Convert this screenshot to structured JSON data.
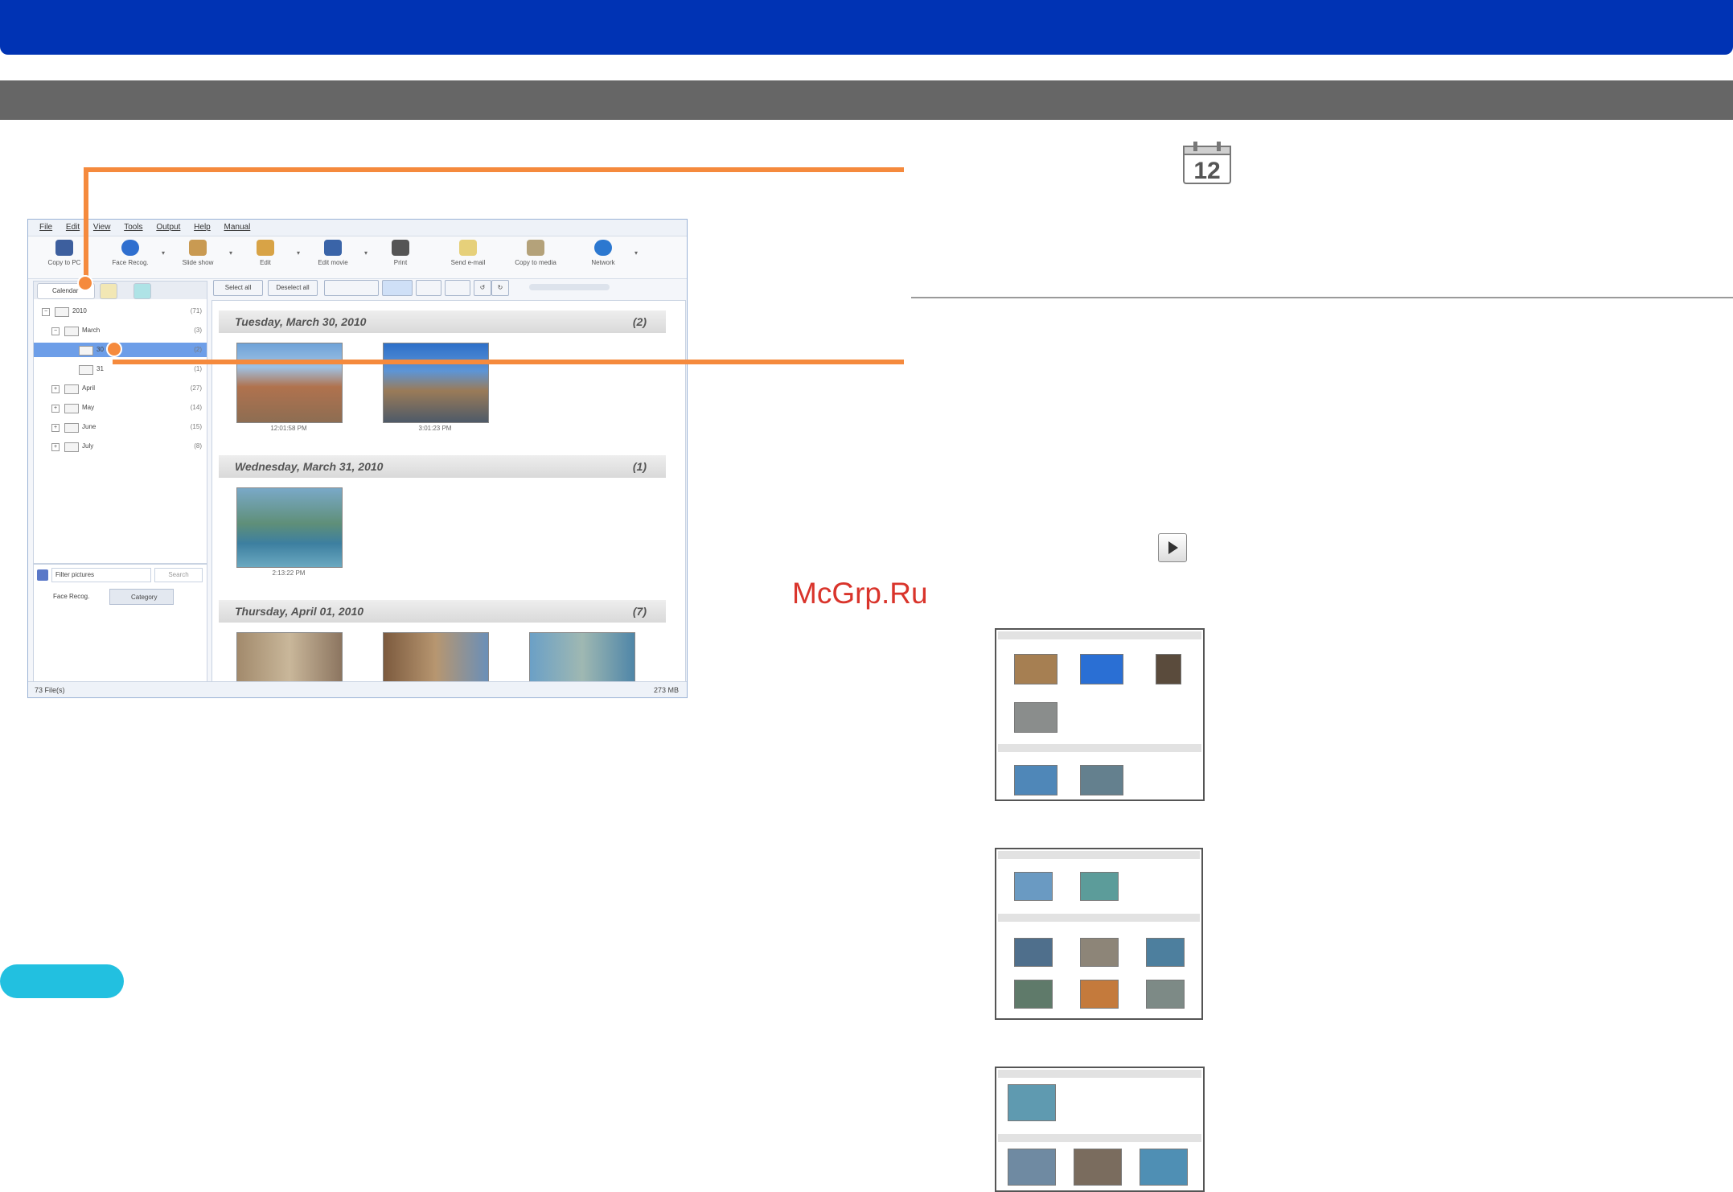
{
  "window": {
    "menu": [
      "File",
      "Edit",
      "View",
      "Tools",
      "Output",
      "Help",
      "Manual"
    ],
    "toolbar": [
      "Copy to PC",
      "Face Recog.",
      "Slide show",
      "Edit",
      "Edit movie",
      "Print",
      "Send e-mail",
      "Copy to media",
      "Network"
    ],
    "left_tabs": [
      "Calendar"
    ],
    "tree": [
      {
        "name": "2010",
        "count": "(71)",
        "expand": "−"
      },
      {
        "name": "March",
        "count": "(3)",
        "expand": "−"
      },
      {
        "name": "30",
        "count": "(2)",
        "expand": ""
      },
      {
        "name": "31",
        "count": "(1)",
        "expand": ""
      },
      {
        "name": "April",
        "count": "(27)",
        "expand": "+"
      },
      {
        "name": "May",
        "count": "(14)",
        "expand": "+"
      },
      {
        "name": "June",
        "count": "(15)",
        "expand": "+"
      },
      {
        "name": "July",
        "count": "(8)",
        "expand": "+"
      }
    ],
    "filter_label": "Filter pictures",
    "filter_button": "Search",
    "bottom_tabs": [
      "Face Recog.",
      "Category"
    ],
    "select_all": "Select all",
    "deselect_all": "Deselect all",
    "groups": [
      {
        "date": "Tuesday, March 30, 2010",
        "count": "(2)",
        "times": [
          "12:01:58 PM",
          "3:01:23 PM"
        ]
      },
      {
        "date": "Wednesday, March 31, 2010",
        "count": "(1)",
        "times": [
          "2:13:22 PM"
        ]
      },
      {
        "date": "Thursday, April 01, 2010",
        "count": "(7)",
        "times": []
      }
    ],
    "status_left": "73 File(s)",
    "status_right": "273 MB"
  },
  "calendar_icon_number": "12",
  "watermark": "McGrp.Ru",
  "colors": {
    "top_bar": "#0033b4",
    "sub_bar": "#666666",
    "callout": "#f58a3d",
    "pill": "#22c0e0"
  }
}
